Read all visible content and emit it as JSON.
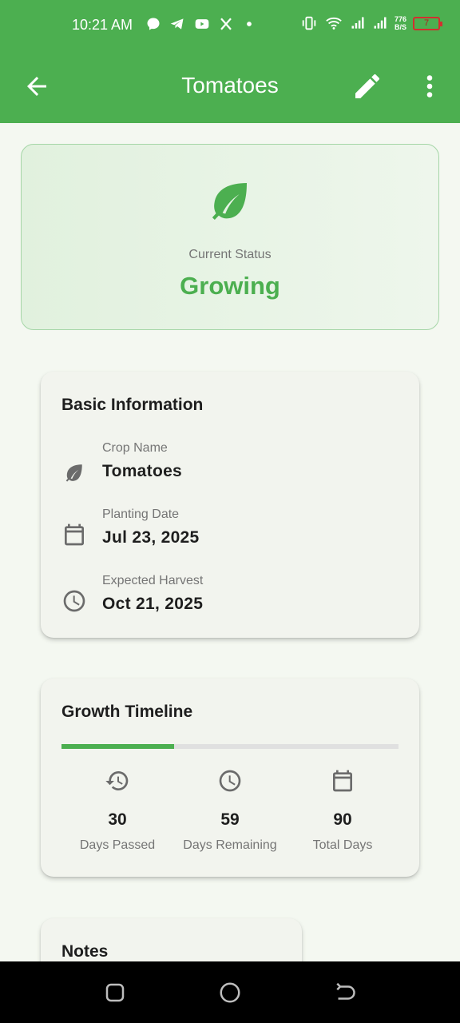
{
  "status_bar": {
    "time": "10:21 AM",
    "left_icons": [
      "messenger-icon",
      "telegram-icon",
      "youtube-icon",
      "x-icon",
      "dot-icon"
    ],
    "right_icons": [
      "vibrate-icon",
      "wifi-icon",
      "signal-icon",
      "signal-icon"
    ],
    "net_speed_top": "776",
    "net_speed_bottom": "B/S",
    "battery": "7"
  },
  "app_bar": {
    "title": "Tomatoes",
    "back_icon": "arrow-back-icon",
    "edit_icon": "pencil-icon",
    "more_icon": "more-vert-icon"
  },
  "status_card": {
    "icon": "leaf-icon",
    "label": "Current Status",
    "value": "Growing"
  },
  "basic_info": {
    "title": "Basic Information",
    "rows": [
      {
        "icon": "leaf-icon",
        "label": "Crop Name",
        "value": "Tomatoes"
      },
      {
        "icon": "calendar-icon",
        "label": "Planting Date",
        "value": "Jul 23, 2025"
      },
      {
        "icon": "clock-icon",
        "label": "Expected Harvest",
        "value": "Oct 21, 2025"
      }
    ]
  },
  "timeline": {
    "title": "Growth Timeline",
    "progress_fraction": 0.333,
    "stats": [
      {
        "icon": "history-icon",
        "value": "30",
        "label": "Days Passed"
      },
      {
        "icon": "clock-icon",
        "value": "59",
        "label": "Days Remaining"
      },
      {
        "icon": "calendar-icon",
        "value": "90",
        "label": "Total Days"
      }
    ]
  },
  "notes": {
    "title": "Notes"
  },
  "nav_bar": {
    "buttons": [
      "recents-icon",
      "home-icon",
      "back-icon"
    ]
  },
  "colors": {
    "primary": "#4caf50",
    "status_border": "#a5d6a7",
    "icon_gray": "#6b6b6b",
    "text_dark": "#1e1e1e",
    "text_muted": "#757575"
  }
}
